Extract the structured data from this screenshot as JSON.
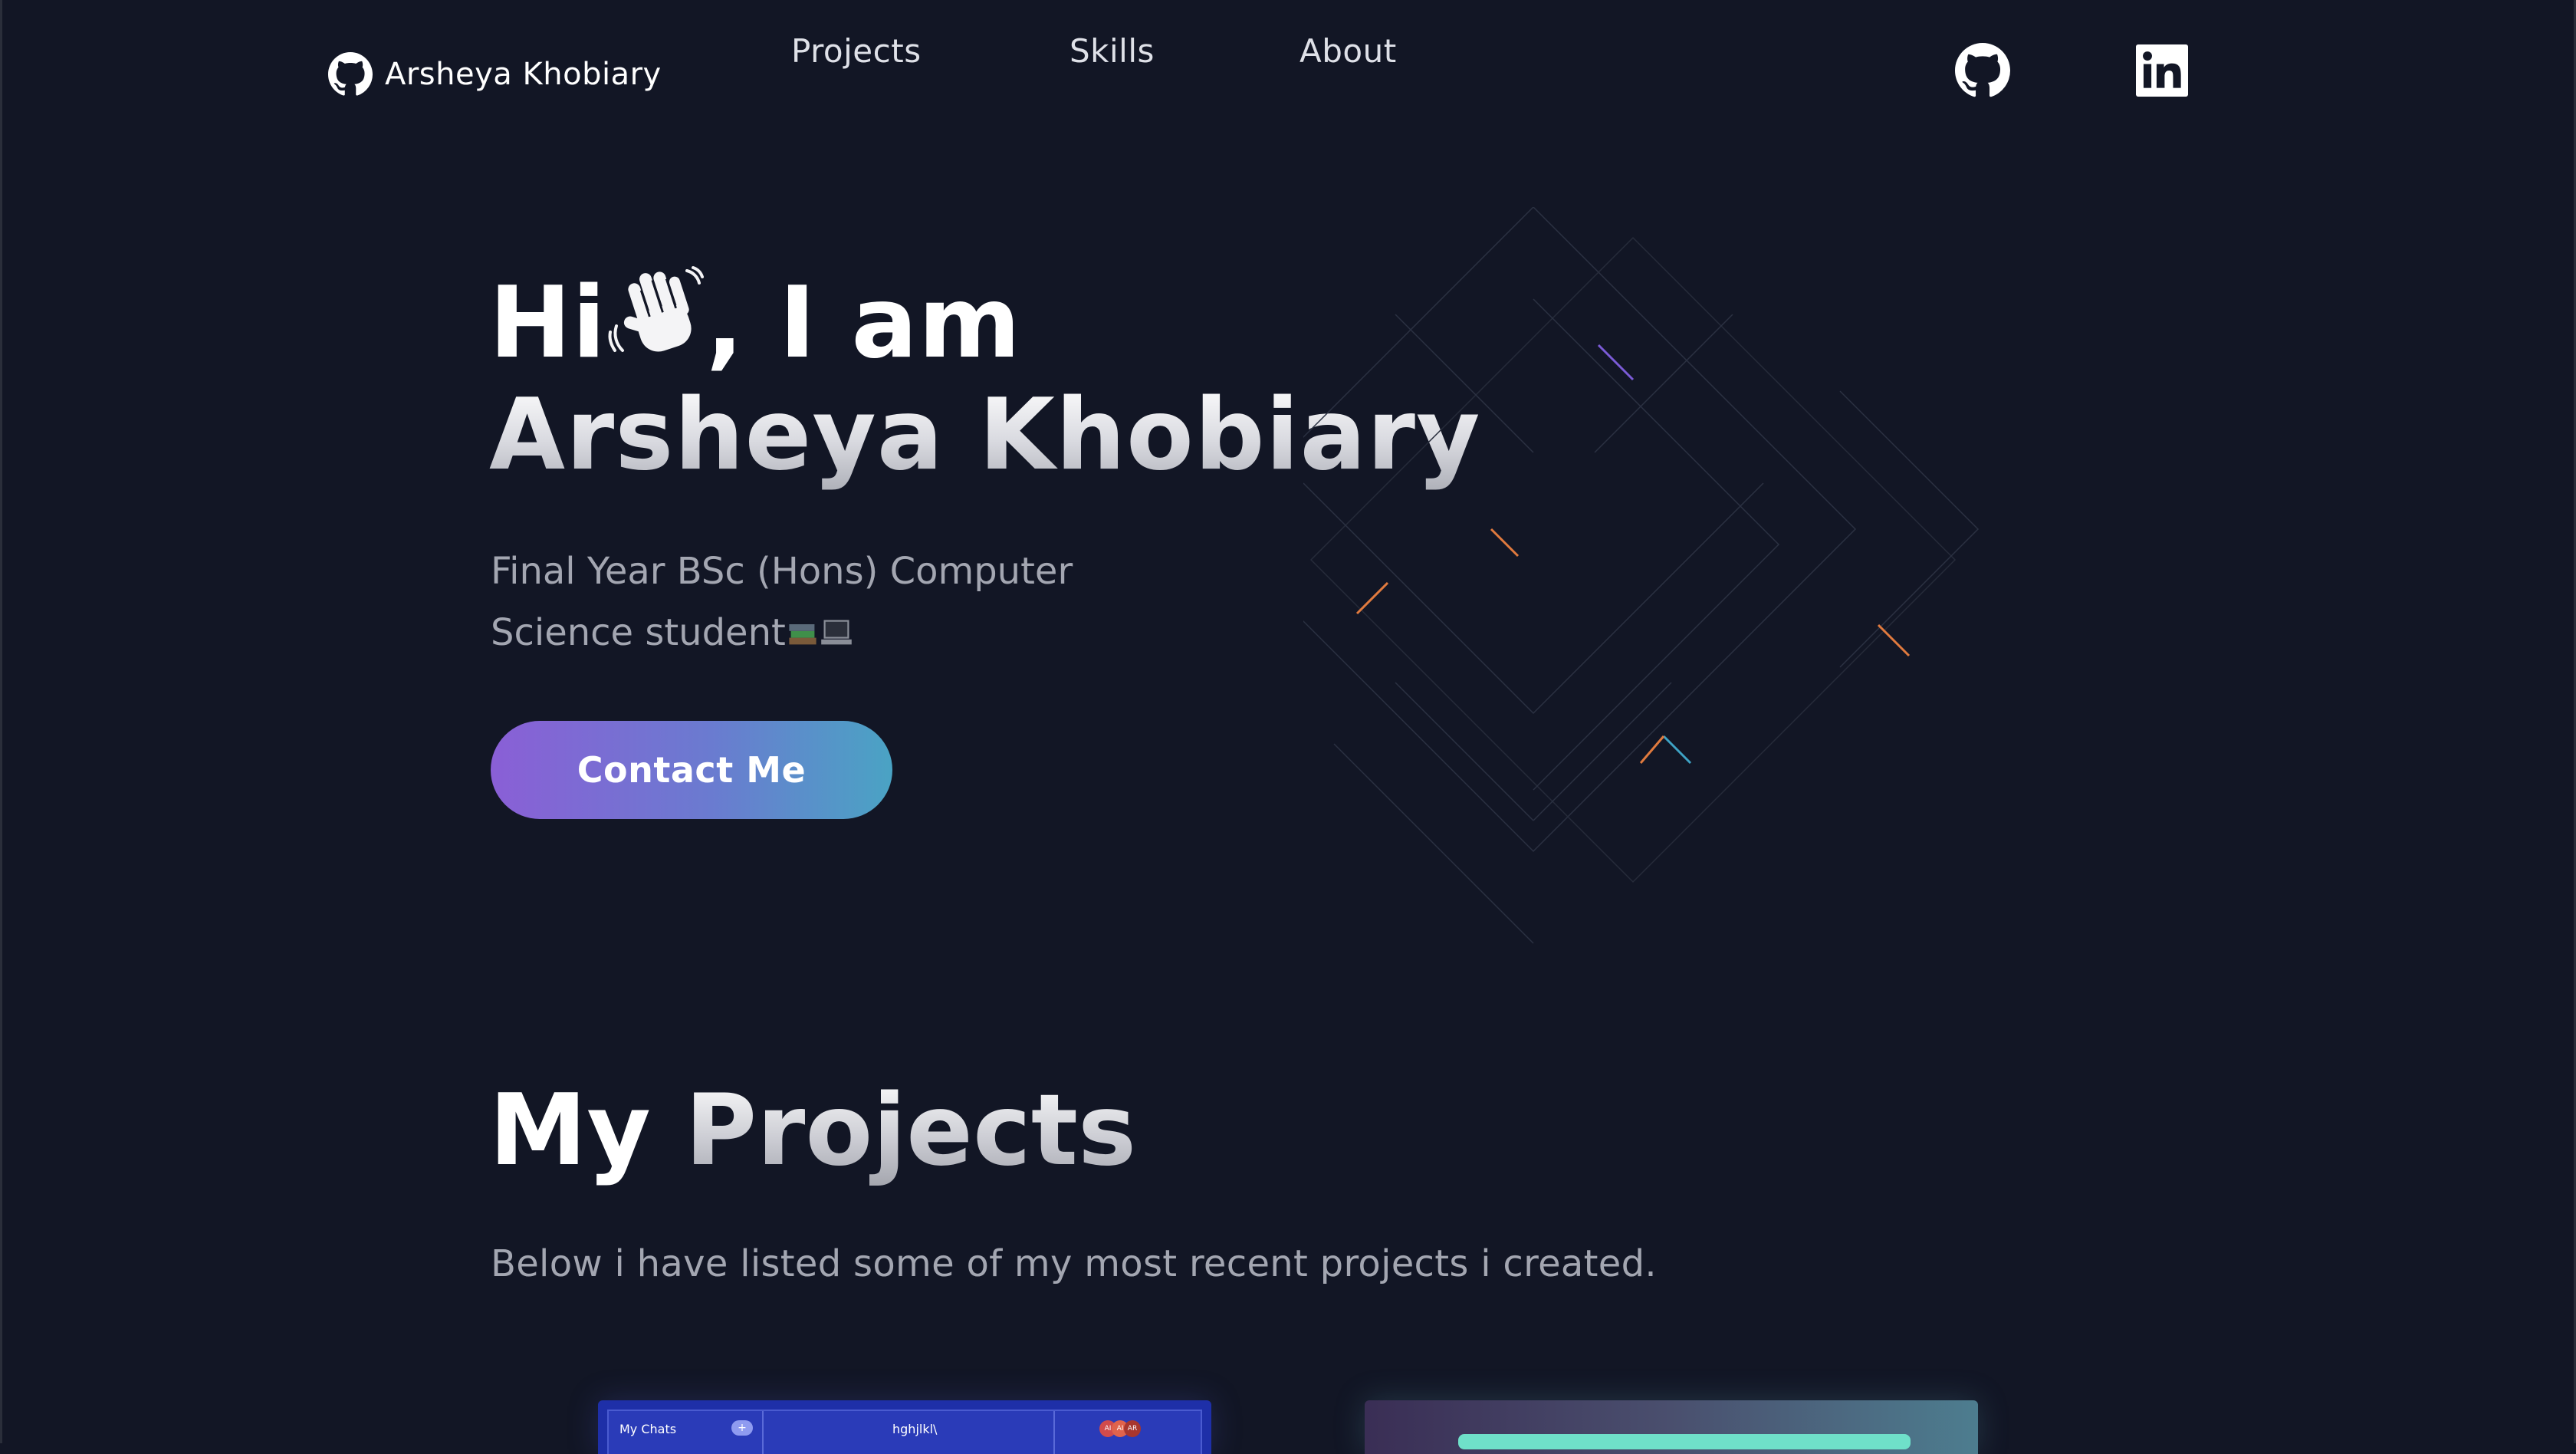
{
  "nav": {
    "brand": "Arsheya Khobiary",
    "links": [
      "Projects",
      "Skills",
      "About"
    ],
    "social": [
      "github-icon",
      "linkedin-icon"
    ]
  },
  "hero": {
    "greeting_prefix": "Hi",
    "greeting_suffix": ", I am",
    "name": "Arsheya Khobiary",
    "subtitle": "Final Year BSc (Hons) Computer Science student",
    "cta": "Contact Me"
  },
  "projects": {
    "title_w1": "My",
    "title_w2": "Projects",
    "description": "Below i have listed some of my most recent projects i created.",
    "card1": {
      "chat_list_title": "My Chats",
      "chat_plus": "+",
      "chat_header": "hghjlkl\\",
      "avatars": [
        "AI",
        "AI",
        "AR"
      ]
    }
  },
  "colors": {
    "background": "#121625",
    "button_gradient_start": "#8a5fd6",
    "button_gradient_end": "#4aa3c4",
    "muted_text": "#a3a6b1"
  }
}
